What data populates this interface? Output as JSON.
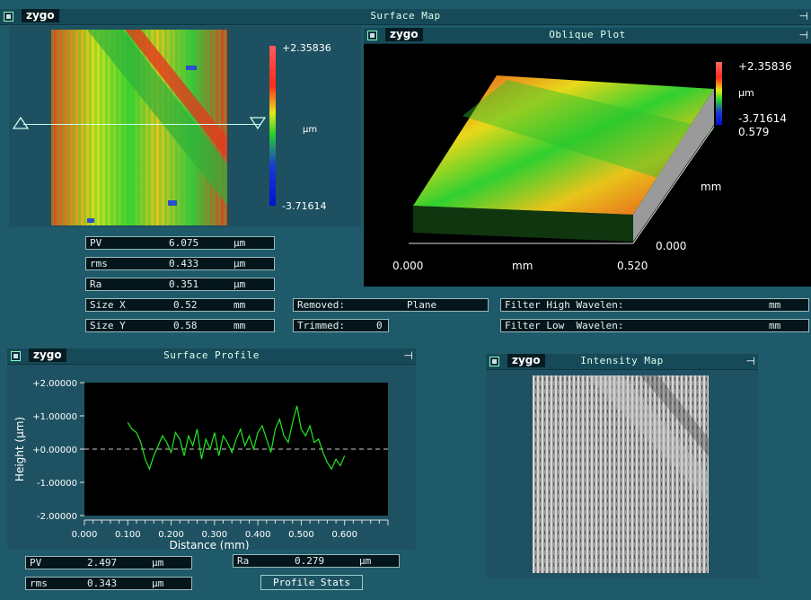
{
  "brand": "zygo",
  "surface_map": {
    "title": "Surface Map",
    "scale_max": "+2.35836",
    "scale_unit": "µm",
    "scale_min": "-3.71614",
    "stats": [
      {
        "label": "PV",
        "value": "6.075",
        "unit": "µm"
      },
      {
        "label": "rms",
        "value": "0.433",
        "unit": "µm"
      },
      {
        "label": "Ra",
        "value": "0.351",
        "unit": "µm"
      },
      {
        "label": "Size X",
        "value": "0.52",
        "unit": "mm"
      },
      {
        "label": "Size Y",
        "value": "0.58",
        "unit": "mm"
      }
    ],
    "removed_label": "Removed:",
    "removed_value": "Plane",
    "trimmed_label": "Trimmed:",
    "trimmed_value": "0",
    "filter_high_label": "Filter High Wavelen:",
    "filter_high_unit": "mm",
    "filter_low_label": "Filter Low  Wavelen:",
    "filter_low_unit": "mm"
  },
  "oblique_plot": {
    "title": "Oblique Plot",
    "scale_max": "+2.35836",
    "scale_unit": "µm",
    "scale_min": "-3.71614",
    "y_max": "0.579",
    "y_unit": "mm",
    "y_min": "0.000",
    "x_min": "0.000",
    "x_unit": "mm",
    "x_max": "0.520"
  },
  "surface_profile": {
    "title": "Surface Profile",
    "stats": [
      {
        "label": "PV",
        "value": "2.497",
        "unit": "µm"
      },
      {
        "label": "rms",
        "value": "0.343",
        "unit": "µm"
      }
    ],
    "ra_label": "Ra",
    "ra_value": "0.279",
    "ra_unit": "µm",
    "profile_stats_button": "Profile Stats"
  },
  "intensity_map": {
    "title": "Intensity Map"
  },
  "chart_data": {
    "type": "line",
    "xlabel": "Distance (mm)",
    "ylabel": "Height (µm)",
    "xlim": [
      0.0,
      0.7
    ],
    "ylim": [
      -2.0,
      2.0
    ],
    "x_ticks": [
      "0.000",
      "0.100",
      "0.200",
      "0.300",
      "0.400",
      "0.500",
      "0.600"
    ],
    "y_ticks": [
      "+2.00000",
      "+1.00000",
      "+0.00000",
      "-1.00000",
      "-2.00000"
    ],
    "series": [
      {
        "color": "#22e822",
        "x": [
          0.1,
          0.11,
          0.12,
          0.13,
          0.14,
          0.15,
          0.16,
          0.17,
          0.18,
          0.19,
          0.2,
          0.21,
          0.22,
          0.23,
          0.24,
          0.25,
          0.26,
          0.27,
          0.28,
          0.29,
          0.3,
          0.31,
          0.32,
          0.33,
          0.34,
          0.35,
          0.36,
          0.37,
          0.38,
          0.39,
          0.4,
          0.41,
          0.42,
          0.43,
          0.44,
          0.45,
          0.46,
          0.47,
          0.48,
          0.49,
          0.5,
          0.51,
          0.52,
          0.53,
          0.54,
          0.55,
          0.56,
          0.57,
          0.58,
          0.59,
          0.6
        ],
        "values": [
          0.8,
          0.6,
          0.5,
          0.2,
          -0.3,
          -0.6,
          -0.2,
          0.1,
          0.4,
          0.2,
          -0.1,
          0.5,
          0.3,
          -0.2,
          0.4,
          0.1,
          0.6,
          -0.3,
          0.3,
          0.0,
          0.5,
          -0.2,
          0.4,
          0.2,
          -0.1,
          0.3,
          0.6,
          0.1,
          0.4,
          0.0,
          0.5,
          0.7,
          0.3,
          -0.1,
          0.6,
          0.9,
          0.4,
          0.2,
          0.8,
          1.3,
          0.6,
          0.4,
          0.7,
          0.2,
          0.3,
          -0.1,
          -0.4,
          -0.6,
          -0.3,
          -0.5,
          -0.2
        ]
      }
    ]
  }
}
